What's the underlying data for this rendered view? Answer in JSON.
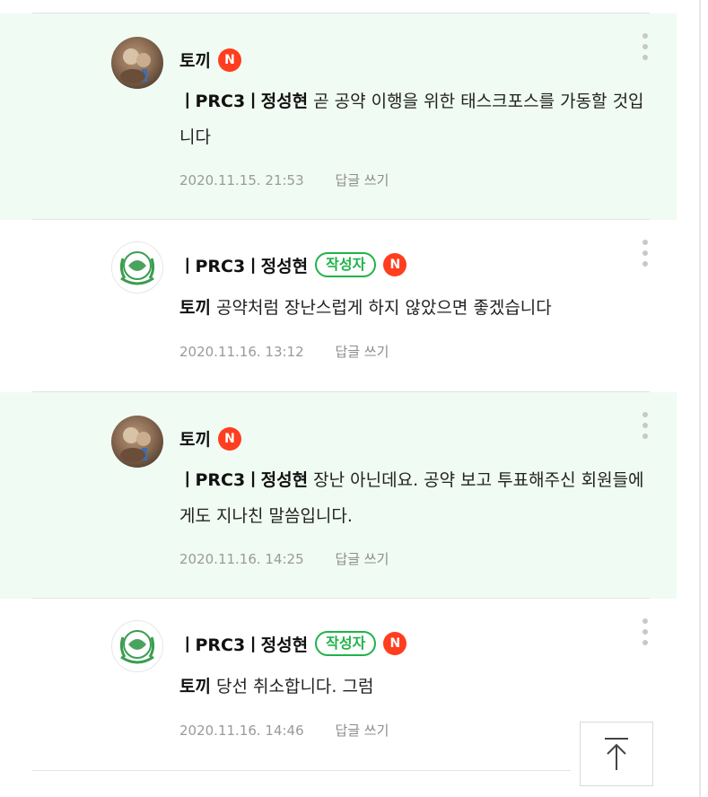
{
  "comments": [
    {
      "author": "토끼",
      "is_author_badge": false,
      "new_badge": "N",
      "reply_to": "ㅣPRC3ㅣ정성현",
      "body": " 곧 공약 이행을 위한 태스크포스를 가동할 것입니다",
      "date": "2020.11.15. 21:53",
      "reply_label": "답글 쓰기",
      "highlighted": true
    },
    {
      "author": "ㅣPRC3ㅣ정성현",
      "author_badge": "작성자",
      "new_badge": "N",
      "reply_to": "토끼",
      "body": " 공약처럼 장난스럽게 하지 않았으면 좋겠습니다",
      "date": "2020.11.16. 13:12",
      "reply_label": "답글 쓰기",
      "highlighted": false
    },
    {
      "author": "토끼",
      "new_badge": "N",
      "reply_to": "ㅣPRC3ㅣ정성현",
      "body": " 장난 아닌데요. 공약 보고 투표해주신 회원들에게도 지나친 말씀입니다.",
      "date": "2020.11.16. 14:25",
      "reply_label": "답글 쓰기",
      "highlighted": true
    },
    {
      "author": "ㅣPRC3ㅣ정성현",
      "author_badge": "작성자",
      "new_badge": "N",
      "reply_to": "토끼",
      "body": " 당선 취소합니다. 그럼",
      "date": "2020.11.16. 14:46",
      "reply_label": "답글 쓰기",
      "highlighted": false
    }
  ],
  "icons": {
    "more": "kebab-menu-icon",
    "scroll_top": "arrow-up-icon"
  },
  "colors": {
    "highlight_bg": "#f0fbf3",
    "author_badge": "#20b34a",
    "new_badge": "#ff3d1f"
  }
}
